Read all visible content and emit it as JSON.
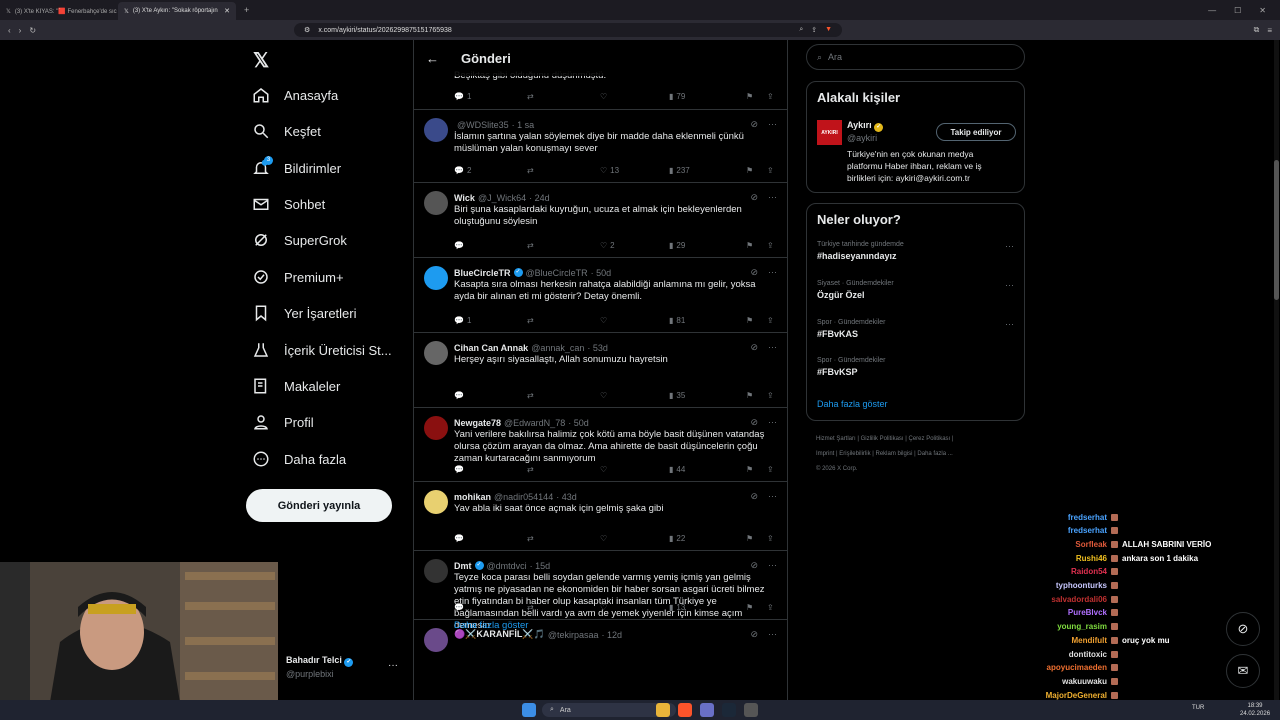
{
  "browser": {
    "tabs": [
      {
        "label": "(3) X'te KIYAS: \"🟥 Fenerbahçe'de sıc"
      },
      {
        "label": "(3) X'te Aykırı: \"Sokak röportajın"
      }
    ],
    "url": "x.com/aykiri/status/2026299875151765938"
  },
  "nav": {
    "items": [
      "Anasayfa",
      "Keşfet",
      "Bildirimler",
      "Sohbet",
      "SuperGrok",
      "Premium+",
      "Yer İşaretleri",
      "İçerik Üreticisi St...",
      "Makaleler",
      "Profil",
      "Daha fazla"
    ],
    "notif_badge": "3",
    "post_button": "Gönderi yayınla",
    "user_name": "Bahadır Telci",
    "user_handle": "@purplebixi"
  },
  "timeline": {
    "title": "Gönderi",
    "top_fragment": {
      "text": "Beşiktaş gibi olduğunu düşünmüştü.",
      "replies": "1",
      "views": "79"
    },
    "tweets": [
      {
        "name": "",
        "handle": "@WDSlite35",
        "time": "· 1 sa",
        "text": "İslamın şartına yalan söylemek diye bir madde daha eklenmeli çünkü müslüman yalan konuşmayı sever",
        "replies": "2",
        "retweets": "",
        "likes": "13",
        "views": "237"
      },
      {
        "name": "Wick",
        "handle": "@J_Wick64",
        "time": "· 24d",
        "text": "Biri şuna kasaplardaki kuyruğun, ucuza et almak için bekleyenlerden oluştuğunu söylesin",
        "replies": "",
        "retweets": "",
        "likes": "2",
        "views": "29"
      },
      {
        "name": "BlueCircleTR",
        "handle": "@BlueCircleTR",
        "time": "· 50d",
        "text": "Kasapta sıra olması herkesin rahatça alabildiği anlamına mı gelir, yoksa ayda bir alınan eti mi gösterir? Detay önemli.",
        "replies": "1",
        "retweets": "",
        "likes": "",
        "views": "81"
      },
      {
        "name": "Cihan Can Annak",
        "handle": "@annak_can",
        "time": "· 53d",
        "text": "Herşey aşırı siyasallaştı, Allah sonumuzu hayretsin",
        "replies": "",
        "retweets": "",
        "likes": "",
        "views": "35"
      },
      {
        "name": "Newgate78",
        "handle": "@EdwardN_78",
        "time": "· 50d",
        "text": "Yani verilere bakılırsa halimiz çok kötü ama böyle basit düşünen vatandaş olursa çözüm arayan da olmaz. Ama ahirette de basit düşüncelerin çoğu zaman kurtaracağını sanmıyorum",
        "replies": "",
        "retweets": "",
        "likes": "",
        "views": "44"
      },
      {
        "name": "mohikan",
        "handle": "@nadir054144",
        "time": "· 43d",
        "text": "Yav abla iki saat önce açmak için gelmiş şaka gibi",
        "replies": "",
        "retweets": "",
        "likes": "",
        "views": "22"
      },
      {
        "name": "Dmt",
        "handle": "@dmtdvci",
        "time": "· 15d",
        "text": "Teyze koca parası belli soydan gelende varmış yemiş içmiş yan gelmiş yatmış ne piyasadan ne ekonomiden bir haber sorsan asgari ücreti bilmez etin fiyatından bi haber olup kasaptaki insanları tüm Türkiye ye bağlamasından belli vardı ya avm de yemek yiyenler için kimse açım demesin",
        "more": "Daha fazla göster",
        "replies": "",
        "retweets": "",
        "likes": "",
        "views": "13"
      },
      {
        "name": "🟣⚔️KARANFİL⚔️🎵",
        "handle": "@tekirpasaa",
        "time": "· 12d"
      }
    ]
  },
  "right": {
    "search_placeholder": "Ara",
    "related_title": "Alakalı kişiler",
    "related": {
      "name": "Aykırı",
      "handle": "@aykiri",
      "button": "Takip ediliyor",
      "bio": "Türkiye'nin en çok okunan medya platformu Haber ihbarı, reklam ve iş birlikleri için: aykiri@aykiri.com.tr",
      "logo_text": "AYKIRI"
    },
    "trends_title": "Neler oluyor?",
    "trends": [
      {
        "context": "Türkiye tarihinde gündemde",
        "title": "#hadiseyanındayız"
      },
      {
        "context": "Siyaset · Gündemdekiler",
        "title": "Özgür Özel"
      },
      {
        "context": "Spor · Gündemdekiler",
        "title": "#FBvKAS"
      },
      {
        "context": "Spor · Gündemdekiler",
        "title": "#FBvKSP"
      }
    ],
    "show_more": "Daha fazla göster",
    "footer": [
      "Hizmet Şartları",
      "Gizlilik Politikası",
      "Çerez Politikası",
      "Imprint",
      "Erişilebilirlik",
      "Reklam bilgisi",
      "Daha fazla ...",
      "© 2026 X Corp."
    ]
  },
  "chat": [
    {
      "user": "fredserhat",
      "msg": "",
      "color": "#4aa3ff"
    },
    {
      "user": "fredserhat",
      "msg": "",
      "color": "#4aa3ff"
    },
    {
      "user": "Sorfleak",
      "msg": "ALLAH SABRINI VERİO",
      "color": "#e05a3a"
    },
    {
      "user": "Rushi46",
      "msg": "ankara son 1 dakika",
      "color": "#f0c020"
    },
    {
      "user": "Raidon54",
      "msg": "",
      "color": "#e03050"
    },
    {
      "user": "typhoonturks",
      "msg": "",
      "color": "#c8c8ff"
    },
    {
      "user": "salvadordali06",
      "msg": "",
      "color": "#c03030"
    },
    {
      "user": "PureBlvck",
      "msg": "",
      "color": "#b070ff"
    },
    {
      "user": "young_rasim",
      "msg": "",
      "color": "#7fdc3f"
    },
    {
      "user": "Mendifult",
      "msg": "oruç yok mu",
      "color": "#f0a030"
    },
    {
      "user": "dontitoxic",
      "msg": "",
      "color": "#e0e0e0"
    },
    {
      "user": "apoyucimaeden",
      "msg": "",
      "color": "#f07030"
    },
    {
      "user": "wakuuwaku",
      "msg": "",
      "color": "#e0e0e0"
    },
    {
      "user": "MajorDeGeneral",
      "msg": "",
      "color": "#f0b030"
    }
  ],
  "taskbar": {
    "search": "Ara",
    "lang": "TUR",
    "time": "18:39",
    "date": "24.02.2026"
  }
}
